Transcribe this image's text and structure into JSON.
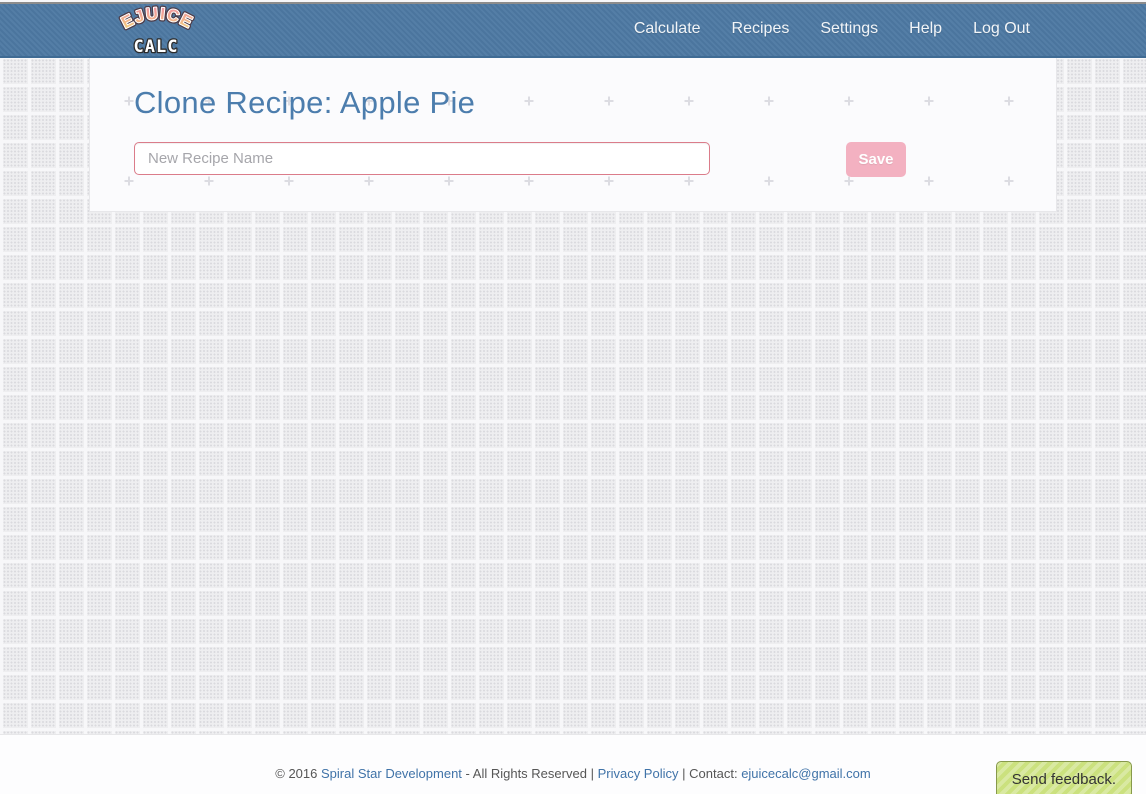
{
  "header": {
    "logo": {
      "line1": "EJUICE",
      "line2": "CALC"
    },
    "nav": [
      {
        "label": "Calculate"
      },
      {
        "label": "Recipes"
      },
      {
        "label": "Settings"
      },
      {
        "label": "Help"
      },
      {
        "label": "Log Out"
      }
    ]
  },
  "main": {
    "title": "Clone Recipe: Apple Pie",
    "recipe_name_input": {
      "placeholder": "New Recipe Name",
      "value": ""
    },
    "save_button": "Save"
  },
  "footer": {
    "copyright": "© 2016",
    "company_link": "Spiral Star Development",
    "rights": "- All Rights Reserved",
    "separator": "|",
    "privacy_link": "Privacy Policy",
    "contact_label": "Contact:",
    "email_link": "ejuicecalc@gmail.com"
  },
  "feedback": {
    "label": "Send feedback."
  },
  "colors": {
    "header_blue": "#4d79a3",
    "header_border": "#3f6b94",
    "title_blue": "#4c7dad",
    "input_border_pink": "#db7c8a",
    "save_pink": "#f3b1c1",
    "link_blue": "#4073a8",
    "feedback_green": "#cbe17e"
  }
}
